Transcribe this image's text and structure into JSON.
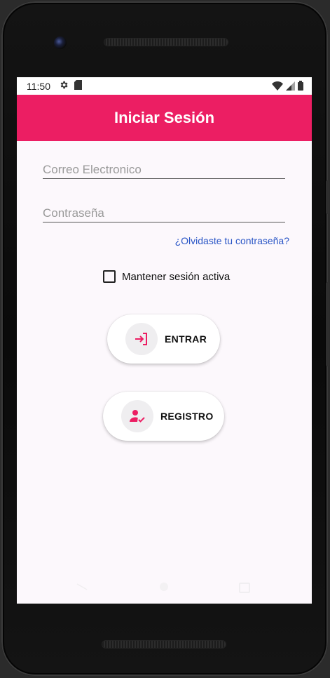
{
  "status": {
    "time": "11:50"
  },
  "appbar": {
    "title": "Iniciar Sesión"
  },
  "form": {
    "email_placeholder": "Correo Electronico",
    "password_placeholder": "Contraseña",
    "forgot_link": "¿Olvidaste tu contraseña?",
    "remember_label": "Mantener sesión activa",
    "remember_checked": false
  },
  "buttons": {
    "enter_label": "ENTRAR",
    "register_label": "REGISTRO"
  },
  "colors": {
    "primary": "#ec1e63",
    "link": "#2a56c6",
    "background": "#fcf8fc"
  },
  "icons": {
    "enter": "login-icon",
    "register": "person-check-icon"
  }
}
